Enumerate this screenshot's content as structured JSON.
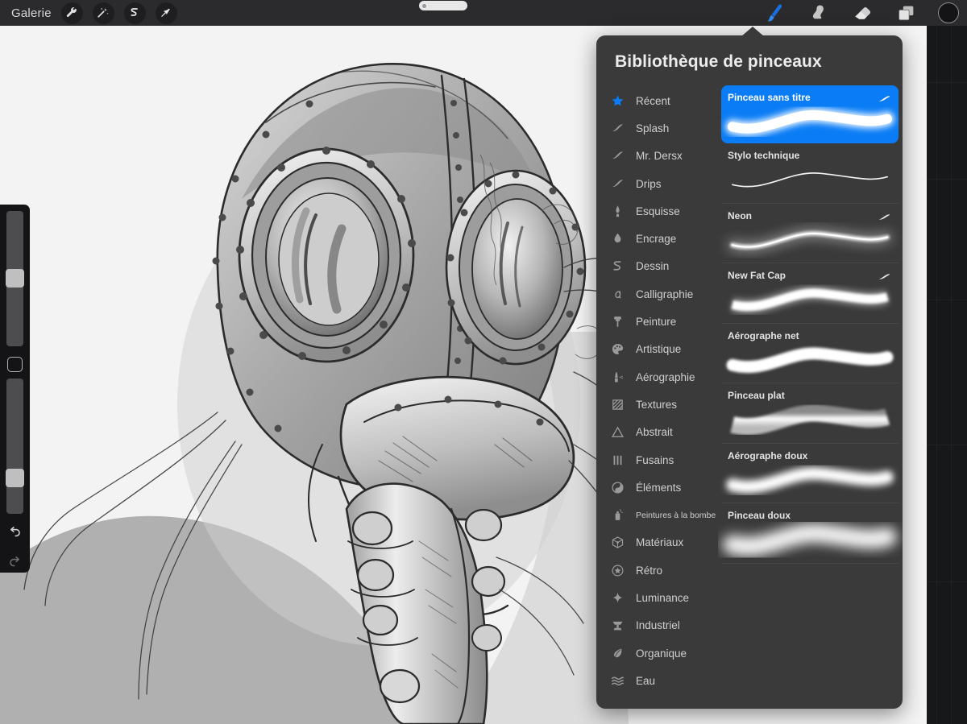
{
  "app": {
    "gallery_label": "Galerie",
    "accent_color": "#0a7cf5",
    "panel_bg": "#3a3a3a",
    "topbar_bg": "#2b2b2d",
    "canvas_bg": "#f2f2f2"
  },
  "topbar": {
    "left_tools": [
      {
        "name": "wrench-icon",
        "label": "Actions"
      },
      {
        "name": "magic-wand-icon",
        "label": "Ajustements"
      },
      {
        "name": "selection-icon",
        "label": "Sélection"
      },
      {
        "name": "transform-arrow-icon",
        "label": "Transformation"
      }
    ],
    "right_tools": [
      {
        "name": "paintbrush-icon",
        "label": "Pinceau",
        "active": true
      },
      {
        "name": "smudge-icon",
        "label": "Doigt",
        "active": false
      },
      {
        "name": "eraser-icon",
        "label": "Gomme",
        "active": false
      },
      {
        "name": "layers-icon",
        "label": "Calques",
        "active": false
      },
      {
        "name": "color-swatch",
        "label": "Couleur",
        "active": false
      }
    ]
  },
  "rail": {
    "size_slider": {
      "name": "brush-size-slider",
      "value_pct": 46
    },
    "modify_button": {
      "name": "modify-button"
    },
    "opacity_slider": {
      "name": "brush-opacity-slider",
      "value_pct": 68
    },
    "undo_button": {
      "name": "undo-button"
    },
    "redo_button": {
      "name": "redo-button"
    }
  },
  "panel": {
    "title": "Bibliothèque de pinceaux",
    "categories": [
      {
        "label": "Récent",
        "icon": "star-icon",
        "starred": true
      },
      {
        "label": "Splash",
        "icon": "stroke-icon"
      },
      {
        "label": "Mr. Dersx",
        "icon": "stroke-icon"
      },
      {
        "label": "Drips",
        "icon": "stroke-icon"
      },
      {
        "label": "Esquisse",
        "icon": "pencil-tip-icon"
      },
      {
        "label": "Encrage",
        "icon": "ink-drop-icon"
      },
      {
        "label": "Dessin",
        "icon": "scribble-icon"
      },
      {
        "label": "Calligraphie",
        "icon": "letter-a-icon"
      },
      {
        "label": "Peinture",
        "icon": "paint-brush-icon"
      },
      {
        "label": "Artistique",
        "icon": "palette-icon"
      },
      {
        "label": "Aérographie",
        "icon": "airbrush-icon"
      },
      {
        "label": "Textures",
        "icon": "hatch-square-icon"
      },
      {
        "label": "Abstrait",
        "icon": "triangle-icon"
      },
      {
        "label": "Fusains",
        "icon": "bars-icon"
      },
      {
        "label": "Éléments",
        "icon": "yin-yang-icon"
      },
      {
        "label": "Peintures à la bombe",
        "icon": "spray-can-icon",
        "small": true
      },
      {
        "label": "Matériaux",
        "icon": "cube-icon"
      },
      {
        "label": "Rétro",
        "icon": "star-circle-icon"
      },
      {
        "label": "Luminance",
        "icon": "sparkle-icon"
      },
      {
        "label": "Industriel",
        "icon": "anvil-icon"
      },
      {
        "label": "Organique",
        "icon": "leaf-icon"
      },
      {
        "label": "Eau",
        "icon": "waves-icon"
      }
    ],
    "brushes": [
      {
        "label": "Pinceau sans titre",
        "selected": true,
        "edited": true,
        "style": "soft-round"
      },
      {
        "label": "Stylo technique",
        "selected": false,
        "edited": false,
        "style": "thin-line"
      },
      {
        "label": "Neon",
        "selected": false,
        "edited": true,
        "style": "neon-glow"
      },
      {
        "label": "New Fat Cap",
        "selected": false,
        "edited": true,
        "style": "fat-cap"
      },
      {
        "label": "Aérographe net",
        "selected": false,
        "edited": false,
        "style": "airbrush-hard"
      },
      {
        "label": "Pinceau plat",
        "selected": false,
        "edited": false,
        "style": "flat-brush"
      },
      {
        "label": "Aérographe doux",
        "selected": false,
        "edited": false,
        "style": "airbrush-soft"
      },
      {
        "label": "Pinceau doux",
        "selected": false,
        "edited": false,
        "style": "soft-brush"
      }
    ]
  },
  "artwork": {
    "name": "gas-mask-sketch",
    "description": "Croquis au crayon d'un masque à gaz tenu par une main"
  }
}
